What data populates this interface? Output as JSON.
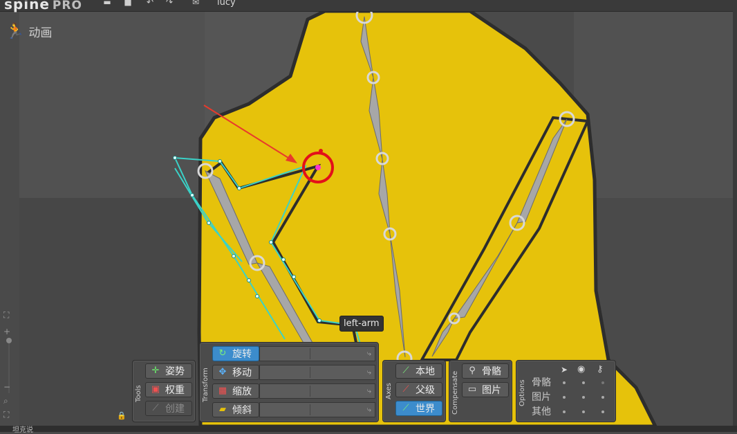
{
  "app": {
    "logo": "spine",
    "edition": "PRO",
    "project_name": "lucy"
  },
  "toolbar_icons": [
    "new-icon",
    "save-icon",
    "undo-icon",
    "redo-icon",
    "mail-icon"
  ],
  "mode": {
    "label": "动画",
    "icon": "running-figure-icon"
  },
  "viewport": {
    "tooltip": "left-arm",
    "body_color": "#e6c20b",
    "highlight_color": "#3ad2c8",
    "annotation_color": "#e83a2c"
  },
  "tools": {
    "title": "Tools",
    "pose": "姿势",
    "weights": "权重",
    "create": "创建"
  },
  "transform": {
    "title": "Transform",
    "rotate": "旋转",
    "translate": "移动",
    "scale": "缩放",
    "shear": "倾斜"
  },
  "axes": {
    "title": "Axes",
    "local": "本地",
    "parent": "父级",
    "world": "世界"
  },
  "compensate": {
    "title": "Compensate",
    "bones": "骨骼",
    "images": "图片"
  },
  "options": {
    "title": "Options",
    "rows": [
      "骨骼",
      "图片",
      "其他"
    ],
    "column_icons": [
      "cursor-icon",
      "eye-icon",
      "key-icon"
    ]
  },
  "bottom_tab": "坦克说"
}
